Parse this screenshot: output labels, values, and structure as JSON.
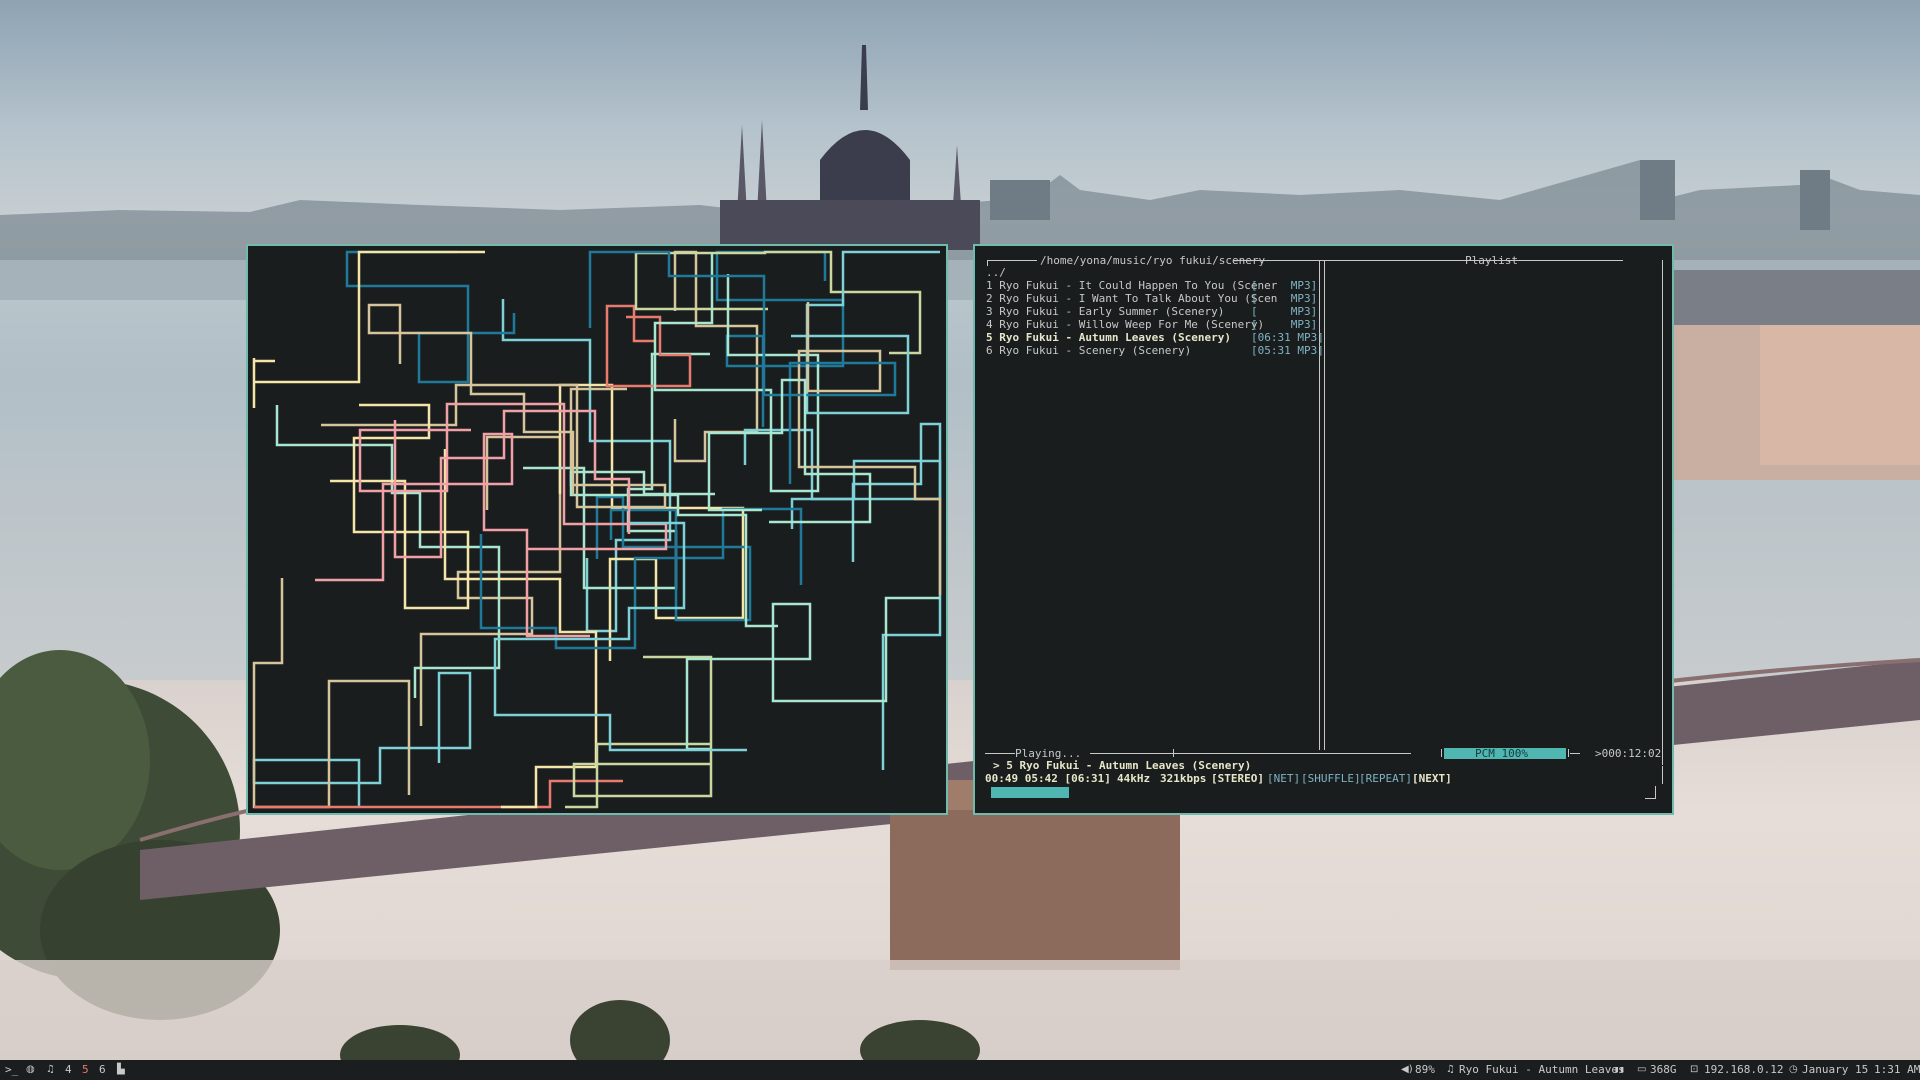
{
  "colors": {
    "accent": "#6fbcaf",
    "terminal_bg": "#1a1d1e",
    "bar_bg": "#1b1e1f",
    "progress_fill": "#4fb6b1",
    "pipe_colors": [
      "#7fd1d8",
      "#a8e6cf",
      "#f5e6a8",
      "#d6c49a",
      "#1f7a99",
      "#e97a6e",
      "#f2a0a8",
      "#c8d8a0"
    ]
  },
  "cmus": {
    "path": "/home/yona/music/ryo fukui/scenery",
    "playlist_title": "Playlist",
    "parent_dir": "../",
    "tracks": [
      {
        "name": "1 Ryo Fukui - It Could Happen To You (Scener",
        "info": "[     MP3]"
      },
      {
        "name": "2 Ryo Fukui - I Want To Talk About You (Scen",
        "info": "[     MP3]"
      },
      {
        "name": "3 Ryo Fukui - Early Summer (Scenery)",
        "info": "[     MP3]"
      },
      {
        "name": "4 Ryo Fukui - Willow Weep For Me (Scenery)",
        "info": "[     MP3]"
      },
      {
        "name": "5 Ryo Fukui - Autumn Leaves (Scenery)",
        "info": "[06:31 MP3]"
      },
      {
        "name": "6 Ryo Fukui - Scenery (Scenery)",
        "info": "[05:31 MP3]"
      }
    ],
    "playing_label": "Playing...",
    "pcm": "PCM 100%",
    "total_time": ">000:12:02",
    "now_playing": "> 5 Ryo Fukui - Autumn Leaves (Scenery)",
    "status": {
      "time": "00:49 05:42 [06:31]",
      "rate": "44kHz",
      "bitrate": "321kbps",
      "stereo": "[STEREO]",
      "net": "[NET]",
      "shuffle": "[SHUFFLE]",
      "repeat": "[REPEAT]",
      "next": "[NEXT]"
    },
    "progress_fraction": 0.125
  },
  "bar": {
    "terminal_glyph": ">_",
    "workspaces": [
      "4",
      "5",
      "6"
    ],
    "active_workspace": "5",
    "volume": "89%",
    "song": "Ryo Fukui - Autumn Leaves",
    "pause_glyph": "▮▮",
    "disk": "368G",
    "ip": "192.168.0.12",
    "date": "January 15",
    "time": "1:31 AM"
  }
}
